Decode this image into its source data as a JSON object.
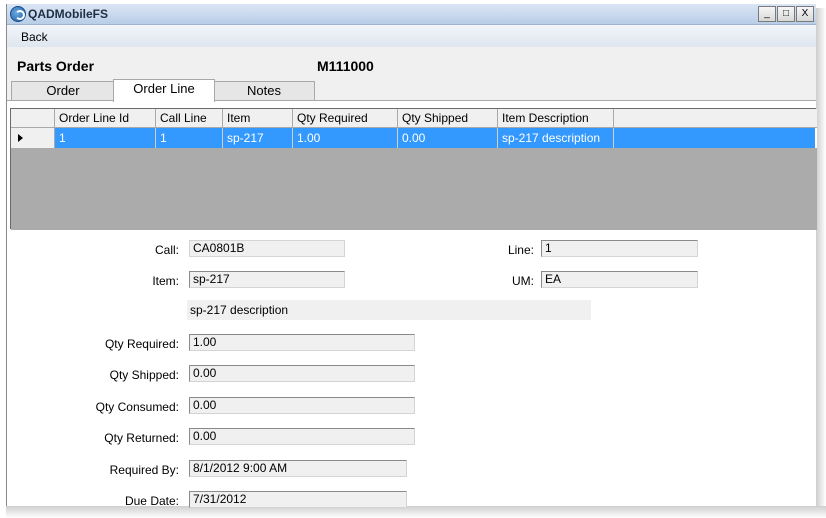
{
  "window": {
    "title": "QADMobileFS",
    "controls": [
      "_",
      "□",
      "X"
    ]
  },
  "menu": {
    "back": "Back"
  },
  "header": {
    "title": "Parts Order",
    "order_number": "M111000"
  },
  "tabs": [
    {
      "label": "Order",
      "selected": false
    },
    {
      "label": "Order Line",
      "selected": true
    },
    {
      "label": "Notes",
      "selected": false
    }
  ],
  "grid": {
    "columns": [
      "Order Line Id",
      "Call Line",
      "Item",
      "Qty Required",
      "Qty Shipped",
      "Item Description"
    ],
    "rows": [
      [
        "1",
        "1",
        "sp-217",
        "1.00",
        "0.00",
        "sp-217 description"
      ]
    ]
  },
  "form": {
    "call": {
      "label": "Call:",
      "value": "CA0801B"
    },
    "line": {
      "label": "Line:",
      "value": "1"
    },
    "item": {
      "label": "Item:",
      "value": "sp-217"
    },
    "um": {
      "label": "UM:",
      "value": "EA"
    },
    "description": "sp-217 description",
    "qty_required": {
      "label": "Qty Required:",
      "value": "1.00"
    },
    "qty_shipped": {
      "label": "Qty Shipped:",
      "value": "0.00"
    },
    "qty_consumed": {
      "label": "Qty Consumed:",
      "value": "0.00"
    },
    "qty_returned": {
      "label": "Qty Returned:",
      "value": "0.00"
    },
    "required_by": {
      "label": "Required By:",
      "value": "8/1/2012 9:00 AM"
    },
    "due_date": {
      "label": "Due Date:",
      "value": "7/31/2012"
    }
  },
  "colors": {
    "selection": "#3399ff",
    "titlebar": "#b9cde8",
    "panel": "#f0f0f0"
  }
}
